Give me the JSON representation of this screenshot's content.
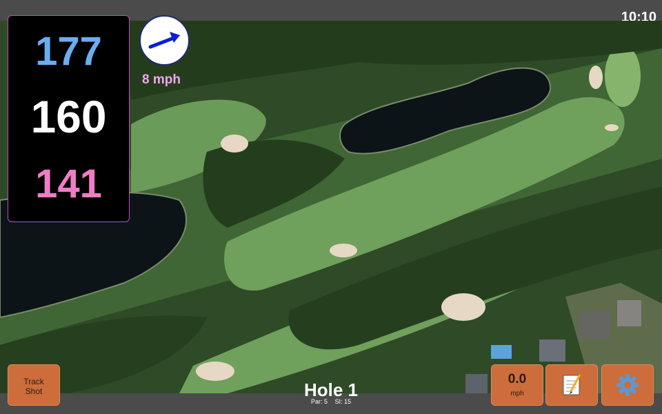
{
  "status": {
    "time": "10:10"
  },
  "yardages": {
    "back": "177",
    "center": "160",
    "front": "141"
  },
  "wind": {
    "speed_label": "8 mph",
    "icon": "wind-direction-arrow-icon"
  },
  "buttons": {
    "track_shot_line1": "Track",
    "track_shot_line2": "Shot",
    "speed_value": "0.0",
    "speed_unit": "mph",
    "notes_icon": "notepad-icon",
    "settings_icon": "gear-icon"
  },
  "hole": {
    "title": "Hole 1",
    "par_label": "Par: 5",
    "si_label": "SI: 15"
  },
  "colors": {
    "back": "#6aaef0",
    "center": "#ffffff",
    "front": "#f07cc4",
    "wind_text": "#f5a3f0",
    "button": "#cc6d3b"
  }
}
